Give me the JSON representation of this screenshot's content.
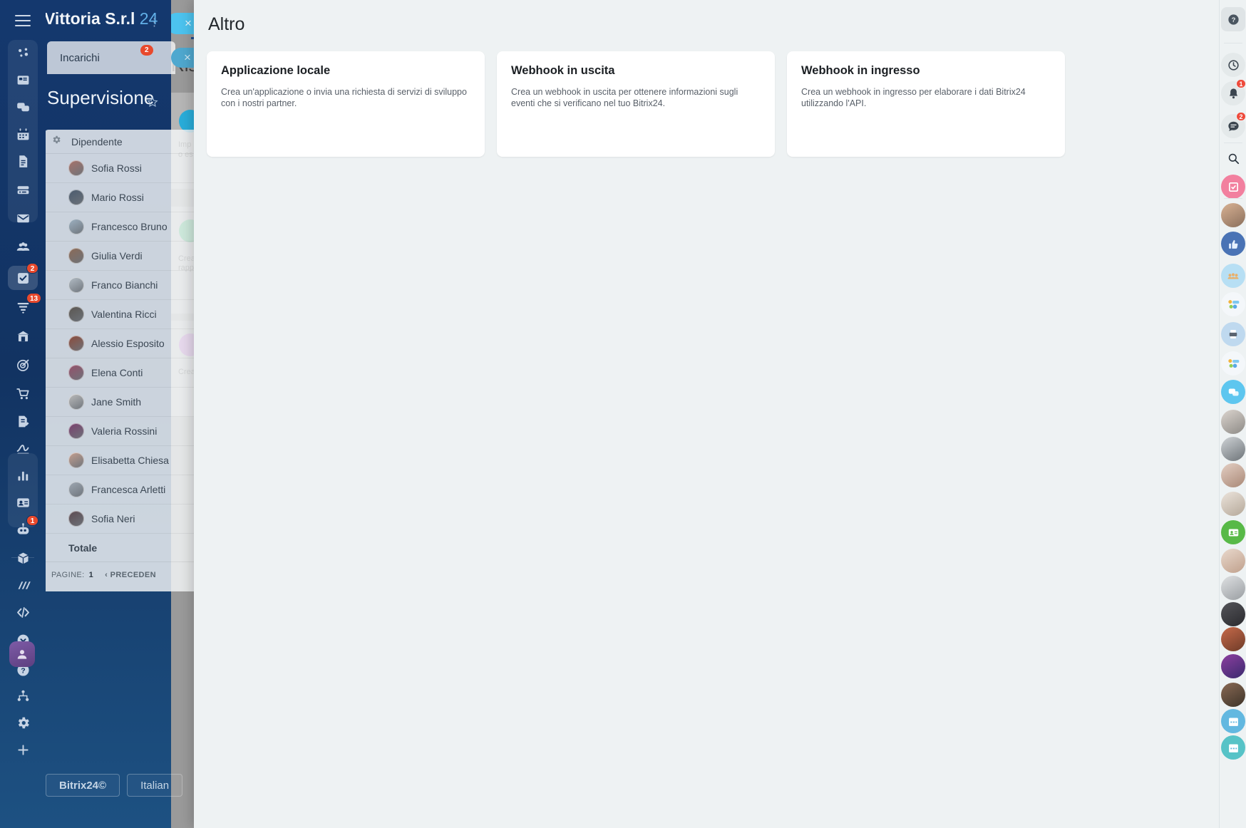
{
  "app": {
    "company_title": "Vittoria S.r.l",
    "company_suffix": "24",
    "menu_dots": "⋮"
  },
  "left_nav": {
    "icons": [
      {
        "name": "network-icon",
        "badge": null
      },
      {
        "name": "news-feed-icon",
        "badge": null
      },
      {
        "name": "chat-icon",
        "badge": null
      },
      {
        "name": "calendar-icon",
        "badge": null
      },
      {
        "name": "documents-icon",
        "badge": null
      },
      {
        "name": "drive-icon",
        "badge": null
      },
      {
        "name": "mail-icon",
        "badge": null
      },
      {
        "name": "groups-icon",
        "badge": null
      },
      {
        "name": "tasks-icon",
        "badge": "2"
      },
      {
        "name": "crm-funnel-icon",
        "badge": "13"
      },
      {
        "name": "company-icon",
        "badge": null
      },
      {
        "name": "marketing-target-icon",
        "badge": null
      },
      {
        "name": "shop-cart-icon",
        "badge": null
      },
      {
        "name": "sign-document-icon",
        "badge": null
      },
      {
        "name": "esignature-icon",
        "badge": null
      },
      {
        "name": "analytics-bars-icon",
        "badge": null
      },
      {
        "name": "contact-card-icon",
        "badge": null
      },
      {
        "name": "bot-icon",
        "badge": "1"
      },
      {
        "name": "market-box-icon",
        "badge": null
      },
      {
        "name": "automation-icon",
        "badge": null
      },
      {
        "name": "developer-code-icon",
        "badge": null
      },
      {
        "name": "chevron-down-icon",
        "badge": null
      },
      {
        "name": "help-question-icon",
        "badge": null
      },
      {
        "name": "sitemap-icon",
        "badge": null
      },
      {
        "name": "settings-gear-icon",
        "badge": null
      },
      {
        "name": "add-plus-icon",
        "badge": null
      }
    ],
    "profile_avatar": "user-avatar"
  },
  "tasks_tab": {
    "label": "Incarichi",
    "badge": "2",
    "close_label": "×"
  },
  "page": {
    "title": "Supervisione",
    "favorite_icon": "star-icon"
  },
  "employees_table": {
    "settings_icon": "gear-icon",
    "column_header": "Dipendente",
    "rows": [
      {
        "name": "Sofia Rossi"
      },
      {
        "name": "Mario Rossi"
      },
      {
        "name": "Francesco Bruno"
      },
      {
        "name": "Giulia Verdi"
      },
      {
        "name": "Franco Bianchi"
      },
      {
        "name": "Valentina Ricci"
      },
      {
        "name": "Alessio Esposito"
      },
      {
        "name": "Elena Conti"
      },
      {
        "name": "Jane Smith"
      },
      {
        "name": "Valeria Rossini"
      },
      {
        "name": "Elisabetta Chiesa"
      },
      {
        "name": "Francesca Arletti"
      },
      {
        "name": "Sofia Neri"
      }
    ],
    "total_label": "Totale",
    "pager": {
      "pages_label": "PAGINE:",
      "page_number": "1",
      "prev_label": "‹ PRECEDEN"
    }
  },
  "footer_buttons": {
    "brand": "Bitrix24©",
    "language": "Italian"
  },
  "background_page": {
    "title": "Risc",
    "close_label": "×",
    "cards": [
      {
        "line1": "Imp",
        "line2": "o es",
        "color": "#29adda"
      },
      {
        "line1": "Crea",
        "line2": "rapp",
        "color": "#1fa85b"
      },
      {
        "line1": "Crea",
        "line2": "",
        "color": "#a84fb5"
      }
    ]
  },
  "slider": {
    "title": "Altro",
    "cards": [
      {
        "title": "Applicazione locale",
        "description": "Crea un'applicazione o invia una richiesta di servizi di sviluppo con i nostri partner."
      },
      {
        "title": "Webhook in uscita",
        "description": "Crea un webhook in uscita per ottenere informazioni sugli eventi che si verificano nel tuo Bitrix24."
      },
      {
        "title": "Webhook in ingresso",
        "description": "Crea un webhook in ingresso per elaborare i dati Bitrix24 utilizzando l'API."
      }
    ]
  },
  "right_rail": {
    "items": [
      {
        "name": "help-icon",
        "badge": null,
        "kind": "sq-help"
      },
      {
        "name": "recent-history-icon",
        "badge": null,
        "kind": "grey"
      },
      {
        "name": "notifications-bell-icon",
        "badge": "1",
        "kind": "grey"
      },
      {
        "name": "messenger-icon",
        "badge": "2",
        "kind": "grey"
      },
      {
        "name": "search-icon",
        "badge": null,
        "kind": "plain"
      },
      {
        "name": "tasks-pink-icon",
        "badge": null,
        "kind": "pink"
      },
      {
        "name": "contact-avatar",
        "badge": null,
        "kind": "photo-a"
      },
      {
        "name": "like-blue-icon",
        "badge": null,
        "kind": "blue"
      },
      {
        "name": "team-group-icon",
        "badge": null,
        "kind": "lightblue"
      },
      {
        "name": "chat-emoji-icon",
        "badge": null,
        "kind": "emoji"
      },
      {
        "name": "printer-icon",
        "badge": null,
        "kind": "lightblue2"
      },
      {
        "name": "chat-emoji-icon-2",
        "badge": null,
        "kind": "emoji"
      },
      {
        "name": "speech-bubble-icon",
        "badge": null,
        "kind": "bubble"
      },
      {
        "name": "contact-avatar-2",
        "badge": null,
        "kind": "photo-b"
      },
      {
        "name": "contact-avatar-3",
        "badge": null,
        "kind": "photo-c"
      },
      {
        "name": "contact-avatar-4",
        "badge": null,
        "kind": "photo-d"
      },
      {
        "name": "contact-avatar-5",
        "badge": null,
        "kind": "photo-e"
      },
      {
        "name": "crm-contact-green-icon",
        "badge": null,
        "kind": "green"
      },
      {
        "name": "contact-avatar-6",
        "badge": null,
        "kind": "photo-f"
      },
      {
        "name": "contact-avatar-7",
        "badge": null,
        "kind": "photo-g"
      },
      {
        "name": "contact-avatar-8",
        "badge": null,
        "kind": "photo-h"
      },
      {
        "name": "contact-avatar-9",
        "badge": null,
        "kind": "photo-i"
      },
      {
        "name": "contact-avatar-10",
        "badge": null,
        "kind": "photo-j"
      },
      {
        "name": "contact-avatar-11",
        "badge": null,
        "kind": "photo-k"
      },
      {
        "name": "calendar-blue-icon",
        "badge": null,
        "kind": "calblue"
      },
      {
        "name": "calendar-teal-icon",
        "badge": null,
        "kind": "calteal"
      }
    ]
  },
  "colors": {
    "nav_bg": "#123362",
    "accent_blue": "#4cc3ef",
    "slider_bg": "#eef2f3",
    "badge_red": "#e8492c"
  }
}
